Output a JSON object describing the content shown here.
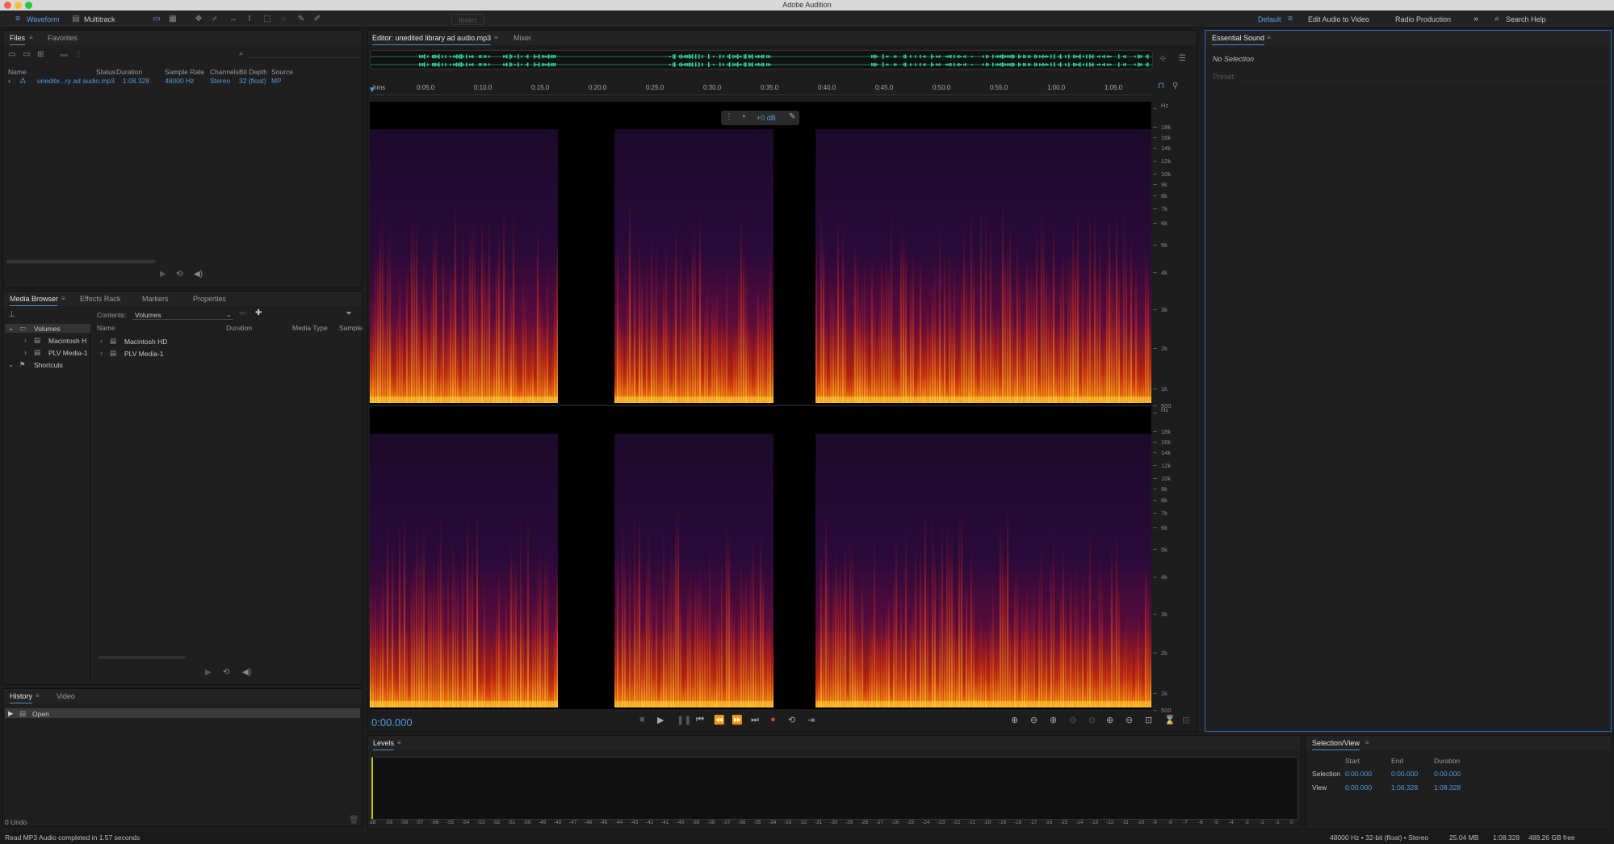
{
  "app": {
    "title": "Adobe Audition"
  },
  "toolbar": {
    "waveform": "Waveform",
    "multitrack": "Multitrack",
    "invert": "Invert",
    "workspaces": [
      "Default",
      "Edit Audio to Video",
      "Radio Production"
    ],
    "search_placeholder": "Search Help"
  },
  "files_panel": {
    "tabs": [
      "Files",
      "Favorites"
    ],
    "columns": [
      "Name",
      "Status",
      "Duration",
      "Sample Rate",
      "Channels",
      "Bit Depth",
      "Source"
    ],
    "rows": [
      {
        "name": "unedite...ry ad audio.mp3",
        "status": "",
        "duration": "1:08.328",
        "sample_rate": "48000 Hz",
        "channels": "Stereo",
        "bit_depth": "32 (float)",
        "source": "MP3 1..."
      }
    ]
  },
  "media_browser": {
    "tabs": [
      "Media Browser",
      "Effects Rack",
      "Markers",
      "Properties"
    ],
    "contents_label": "Contents:",
    "contents_value": "Volumes",
    "tree": [
      "Volumes",
      "Macintosh H",
      "PLV Media-1",
      "Shortcuts"
    ],
    "columns": [
      "Name",
      "Duration",
      "Media Type",
      "Sample"
    ],
    "items": [
      "Macintosh HD",
      "PLV Media-1"
    ]
  },
  "history": {
    "tabs": [
      "History",
      "Video"
    ],
    "items": [
      "Open"
    ],
    "undo_count": "0 Undo"
  },
  "editor": {
    "tabs": [
      "Editor: unedited library ad audio.mp3",
      "Mixer"
    ],
    "ruler": [
      "hms",
      "0:05.0",
      "0:10.0",
      "0:15.0",
      "0:20.0",
      "0:25.0",
      "0:30.0",
      "0:35.0",
      "0:40.0",
      "0:45.0",
      "0:50.0",
      "0:55.0",
      "1:00.0",
      "1:05.0"
    ],
    "hud_db": "+0 dB",
    "freq_labels": [
      "Hz",
      "18k",
      "16k",
      "14k",
      "12k",
      "10k",
      "9k",
      "8k",
      "7k",
      "6k",
      "5k",
      "4k",
      "3k",
      "2k",
      "1k",
      "500"
    ],
    "time": "0:00.000"
  },
  "essential_sound": {
    "title": "Essential Sound",
    "no_selection": "No Selection",
    "preset_label": "Preset:"
  },
  "levels": {
    "title": "Levels",
    "scale": [
      "dB",
      "-59",
      "-58",
      "-57",
      "-56",
      "-55",
      "-54",
      "-53",
      "-52",
      "-51",
      "-50",
      "-49",
      "-48",
      "-47",
      "-46",
      "-45",
      "-44",
      "-43",
      "-42",
      "-41",
      "-40",
      "-39",
      "-38",
      "-37",
      "-36",
      "-35",
      "-34",
      "-33",
      "-32",
      "-31",
      "-30",
      "-29",
      "-28",
      "-27",
      "-26",
      "-25",
      "-24",
      "-23",
      "-22",
      "-21",
      "-20",
      "-19",
      "-18",
      "-17",
      "-16",
      "-15",
      "-14",
      "-13",
      "-12",
      "-11",
      "-10",
      "-9",
      "-8",
      "-7",
      "-6",
      "-5",
      "-4",
      "-3",
      "-2",
      "-1",
      "0"
    ]
  },
  "selection_view": {
    "title": "Selection/View",
    "headers": [
      "Start",
      "End",
      "Duration"
    ],
    "selection_label": "Selection",
    "selection": [
      "0:00.000",
      "0:00.000",
      "0:00.000"
    ],
    "view_label": "View",
    "view": [
      "0:00.000",
      "1:08.328",
      "1:08.328"
    ]
  },
  "status_bar": {
    "left": "Read MP3 Audio completed in 1.57 seconds",
    "format": "48000 Hz • 32-bit (float) • Stereo",
    "size": "25.04 MB",
    "duration": "1:08.328",
    "free": "488.26 GB free"
  }
}
